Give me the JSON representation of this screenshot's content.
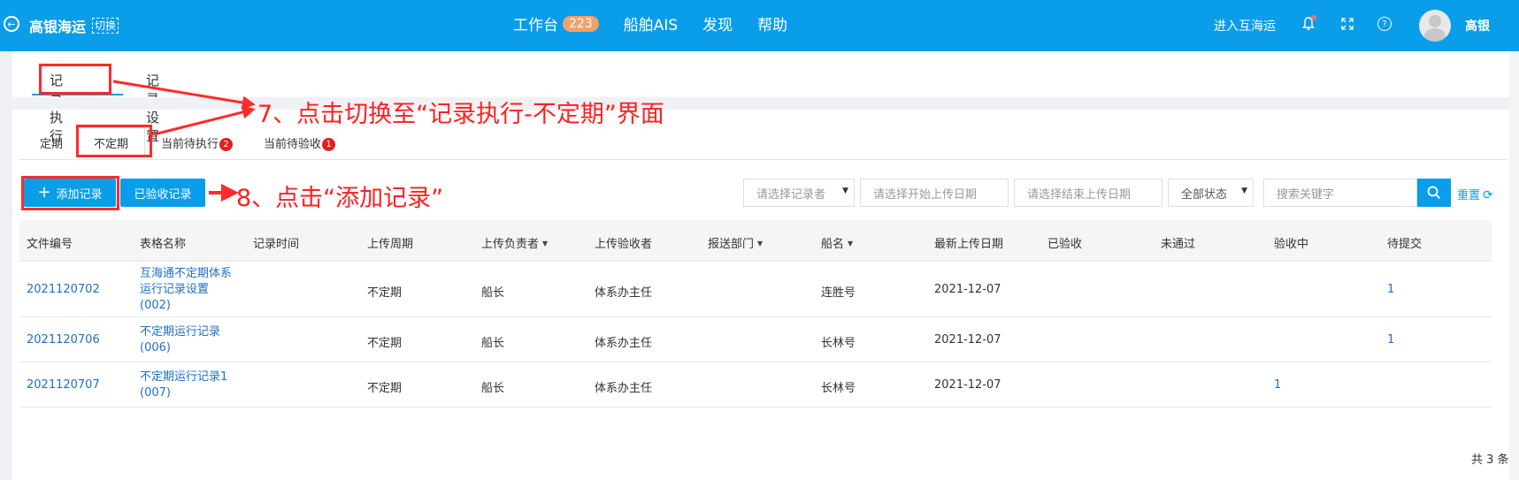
{
  "header": {
    "brand": "高银海运",
    "switch_label": "切换",
    "nav": [
      {
        "label": "工作台",
        "badge": "223"
      },
      {
        "label": "船舶AIS"
      },
      {
        "label": "发现"
      },
      {
        "label": "帮助"
      }
    ],
    "enter_link": "进入互海运",
    "user_name": "高银",
    "icons": [
      "back-icon",
      "bell-icon",
      "fullscreen-icon",
      "help-icon"
    ]
  },
  "module_tabs": [
    {
      "label": "记录执行",
      "active": true
    },
    {
      "label": "记录设置",
      "active": false
    }
  ],
  "sub_tabs": [
    {
      "label": "定期",
      "badge": null
    },
    {
      "label": "不定期",
      "badge": null,
      "active": true
    },
    {
      "label": "当前待执行",
      "badge": "2"
    },
    {
      "label": "当前待验收",
      "badge": "1"
    }
  ],
  "toolbar": {
    "add_label": "添加记录",
    "accepted_label": "已验收记录",
    "recorder_placeholder": "请选择记录者",
    "start_placeholder": "请选择开始上传日期",
    "end_placeholder": "请选择结束上传日期",
    "status_value": "全部状态",
    "search_placeholder": "搜索关键字",
    "reset_label": "重置"
  },
  "table": {
    "columns": [
      "文件编号",
      "表格名称",
      "记录时间",
      "上传周期",
      "上传负责者",
      "上传验收者",
      "报送部门",
      "船名",
      "最新上传日期",
      "已验收",
      "未通过",
      "验收中",
      "待提交"
    ],
    "rows": [
      {
        "file_no": "2021120702",
        "name": "互海通不定期体系运行记录设置 (002)",
        "record_time": "",
        "cycle": "不定期",
        "owner": "船长",
        "acceptor": "体系办主任",
        "dept": "",
        "ship": "连胜号",
        "last_date": "2021-12-07",
        "accepted": "",
        "failed": "",
        "in_review": "",
        "pending": "1"
      },
      {
        "file_no": "2021120706",
        "name": "不定期运行记录 (006)",
        "record_time": "",
        "cycle": "不定期",
        "owner": "船长",
        "acceptor": "体系办主任",
        "dept": "",
        "ship": "长林号",
        "last_date": "2021-12-07",
        "accepted": "",
        "failed": "",
        "in_review": "",
        "pending": "1"
      },
      {
        "file_no": "2021120707",
        "name": "不定期运行记录1 (007)",
        "record_time": "",
        "cycle": "不定期",
        "owner": "船长",
        "acceptor": "体系办主任",
        "dept": "",
        "ship": "长林号",
        "last_date": "2021-12-07",
        "accepted": "",
        "failed": "",
        "in_review": "1",
        "pending": ""
      }
    ]
  },
  "pagination": {
    "total": "共 3 条"
  },
  "annotations": {
    "step7": "7、点击切换至“记录执行-不定期”界面",
    "step8": "8、点击“添加记录”"
  },
  "colors": {
    "primary": "#0a9dea",
    "badge_orange": "#f4a06a",
    "annotation_red": "#ff2020",
    "link": "#1e6fc7"
  }
}
